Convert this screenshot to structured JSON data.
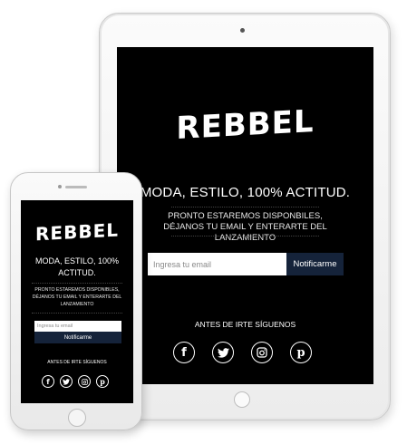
{
  "brand": {
    "logo_text": "REBBEL"
  },
  "hero": {
    "headline": "MODA, ESTILO, 100% ACTITUD.",
    "phone_headline_line1": "MODA, ESTILO, 100%",
    "phone_headline_line2": "ACTITUD.",
    "subtext": "PRONTO ESTAREMOS DISPONBILES, DÉJANOS TU EMAIL Y ENTERARTE DEL LANZAMIENTO",
    "phone_subtext": "PRONTO ESTAREMOS DISPONIBLES, DÉJANOS TU EMAIL Y ENTERARTE DEL LANZAMIENTO"
  },
  "signup": {
    "email_placeholder": "Ingresa tu email",
    "submit_label": "Notificarme"
  },
  "follow": {
    "label": "ANTES DE IRTE SÍGUENOS",
    "icons": [
      "facebook-icon",
      "twitter-icon",
      "instagram-icon",
      "pinterest-icon"
    ]
  },
  "colors": {
    "screen_bg": "#000000",
    "button_bg": "#15233a",
    "text": "#ffffff"
  }
}
